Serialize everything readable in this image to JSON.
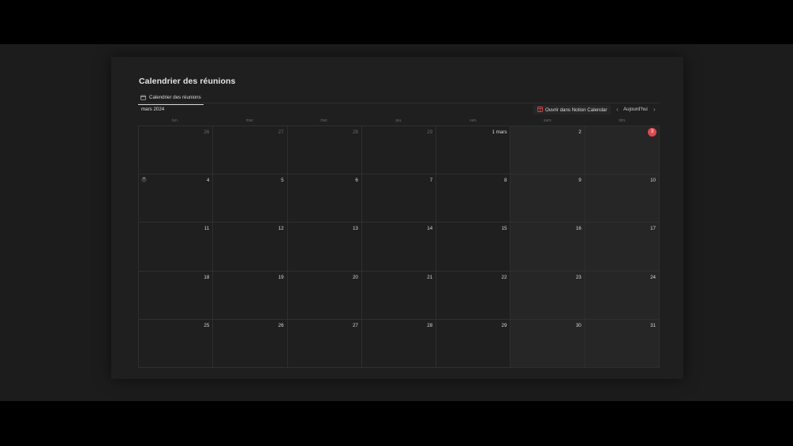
{
  "page": {
    "title": "Calendrier des réunions",
    "view_tab": {
      "label": "Calendrier des réunions",
      "icon": "calendar-icon"
    }
  },
  "toolbar": {
    "month": "mars 2024",
    "open_notion_calendar": "Ouvrir dans Notion Calendar",
    "prev": "‹",
    "today": "Aujourd'hui",
    "next": "›"
  },
  "weekdays": [
    "lun.",
    "mar.",
    "mer.",
    "jeu.",
    "ven.",
    "sam.",
    "dim."
  ],
  "weeks": [
    [
      {
        "label": "26",
        "outside": true
      },
      {
        "label": "27",
        "outside": true
      },
      {
        "label": "28",
        "outside": true
      },
      {
        "label": "29",
        "outside": true
      },
      {
        "label": "1 mars",
        "outside": false
      },
      {
        "label": "2",
        "outside": false
      },
      {
        "label": "3",
        "outside": false,
        "today": true
      }
    ],
    [
      {
        "label": "4",
        "add": true
      },
      {
        "label": "5"
      },
      {
        "label": "6"
      },
      {
        "label": "7"
      },
      {
        "label": "8"
      },
      {
        "label": "9"
      },
      {
        "label": "10"
      }
    ],
    [
      {
        "label": "11"
      },
      {
        "label": "12"
      },
      {
        "label": "13"
      },
      {
        "label": "14"
      },
      {
        "label": "15"
      },
      {
        "label": "16"
      },
      {
        "label": "17"
      }
    ],
    [
      {
        "label": "18"
      },
      {
        "label": "19"
      },
      {
        "label": "20"
      },
      {
        "label": "21"
      },
      {
        "label": "22"
      },
      {
        "label": "23"
      },
      {
        "label": "24"
      }
    ],
    [
      {
        "label": "25"
      },
      {
        "label": "26"
      },
      {
        "label": "27"
      },
      {
        "label": "28"
      },
      {
        "label": "29"
      },
      {
        "label": "30"
      },
      {
        "label": "31"
      }
    ]
  ],
  "colors": {
    "today_badge": "#e2484f",
    "notion_calendar_icon": "#e2484f"
  }
}
